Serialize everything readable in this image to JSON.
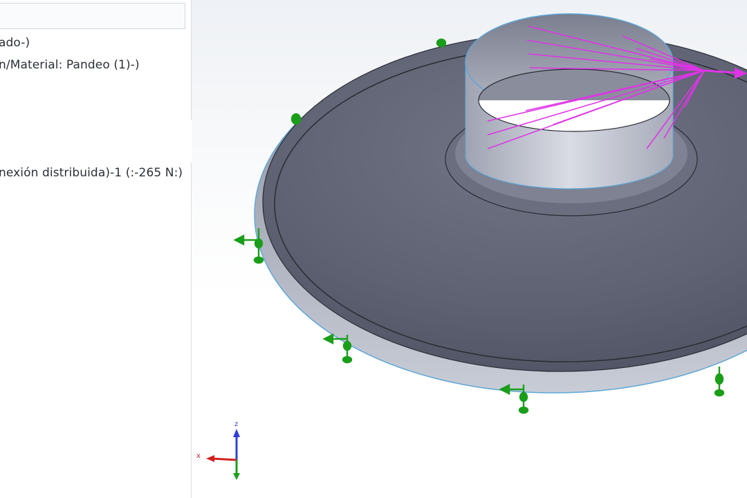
{
  "tree": {
    "lines": [
      "ado-)",
      "n/Material: Pandeo (1)-)",
      "nexión distribuida)-1 (:-265 N:)"
    ]
  },
  "viewport": {
    "triad": {
      "x_label": "x",
      "z_label": "z"
    },
    "colors": {
      "model": "#5c6070",
      "fixture": "#1a9e1a",
      "load": "#e033e8",
      "x_axis": "#d22020",
      "y_axis": "#1aa01a",
      "z_axis": "#2d3fd6"
    }
  }
}
